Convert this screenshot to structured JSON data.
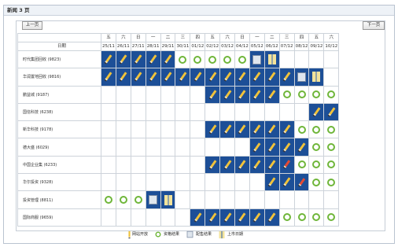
{
  "window": {
    "title": "新闻 3 页"
  },
  "nav": {
    "prev": "上一页",
    "next": "下一页"
  },
  "header": {
    "label": "日期",
    "weekdays": [
      "五",
      "六",
      "日",
      "一",
      "二",
      "三",
      "四",
      "五",
      "六",
      "日",
      "一",
      "二",
      "三",
      "四",
      "五",
      "六"
    ],
    "weekday_red": [
      false,
      true,
      true,
      false,
      false,
      false,
      false,
      false,
      true,
      true,
      false,
      false,
      false,
      false,
      false,
      true
    ],
    "dates": [
      "25/11",
      "26/11",
      "27/11",
      "28/11",
      "29/11",
      "30/11",
      "01/12",
      "02/12",
      "03/12",
      "04/12",
      "05/12",
      "06/12",
      "07/12",
      "08/12",
      "09/12",
      "10/12"
    ],
    "date_red": [
      false,
      true,
      true,
      false,
      false,
      false,
      false,
      false,
      true,
      true,
      false,
      false,
      false,
      false,
      false,
      true
    ]
  },
  "rows": [
    {
      "name": "时代集团回收 (9823)",
      "cells": [
        "P",
        "P",
        "P",
        "P",
        "P",
        "R",
        "R",
        "R",
        "R",
        "R",
        "PH",
        "DR",
        "W",
        "W",
        "W",
        "W"
      ]
    },
    {
      "name": "华润置地回收 (9816)",
      "cells": [
        "P",
        "P",
        "P",
        "P",
        "P",
        "P",
        "P",
        "P",
        "P",
        "P",
        "P",
        "P",
        "P",
        "PH",
        "DR",
        "W"
      ]
    },
    {
      "name": "鹏益城 (9187)",
      "cells": [
        "W",
        "W",
        "W",
        "W",
        "W",
        "W",
        "W",
        "P",
        "P",
        "P",
        "P",
        "P",
        "R",
        "R",
        "R",
        "R"
      ]
    },
    {
      "name": "国信科技 (6238)",
      "cells": [
        "W",
        "W",
        "W",
        "W",
        "W",
        "W",
        "W",
        "W",
        "W",
        "W",
        "W",
        "W",
        "W",
        "W",
        "P",
        "P"
      ]
    },
    {
      "name": "新华科技 (9178)",
      "cells": [
        "W",
        "W",
        "W",
        "W",
        "W",
        "W",
        "W",
        "P",
        "P",
        "P",
        "P",
        "P",
        "P",
        "R",
        "R",
        "R"
      ]
    },
    {
      "name": "德大盛 (6029)",
      "cells": [
        "W",
        "W",
        "W",
        "W",
        "W",
        "W",
        "W",
        "W",
        "W",
        "W",
        "P",
        "P",
        "P",
        "P",
        "R",
        "R"
      ]
    },
    {
      "name": "中国企业集 (6233)",
      "cells": [
        "W",
        "W",
        "W",
        "W",
        "W",
        "W",
        "W",
        "P",
        "P",
        "P",
        "P",
        "P",
        "RP",
        "R",
        "R",
        "R"
      ]
    },
    {
      "name": "华尔投资 (9328)",
      "cells": [
        "W",
        "W",
        "W",
        "W",
        "W",
        "W",
        "W",
        "W",
        "W",
        "W",
        "W",
        "P",
        "P",
        "RP",
        "R",
        "R"
      ]
    },
    {
      "name": "投资管理 (8811)",
      "cells": [
        "R",
        "R",
        "R",
        "PH",
        "DR",
        "W",
        "W",
        "W",
        "W",
        "W",
        "W",
        "W",
        "W",
        "W",
        "W",
        "W"
      ]
    },
    {
      "name": "国际商服 (9659)",
      "cells": [
        "W",
        "W",
        "W",
        "W",
        "W",
        "W",
        "P",
        "P",
        "P",
        "P",
        "P",
        "P",
        "R",
        "R",
        "R",
        "R"
      ]
    }
  ],
  "legend": [
    {
      "label": "网站开放",
      "icon": "pencil-icon"
    },
    {
      "label": "资格结果",
      "icon": "ring-icon"
    },
    {
      "label": "配售结果",
      "icon": "photo-icon"
    },
    {
      "label": "上市日期",
      "icon": "drinks-icon"
    }
  ],
  "colors": {
    "accent": "#1d4f97",
    "ring": "#6fb63a",
    "weekend": "#d0281e"
  }
}
